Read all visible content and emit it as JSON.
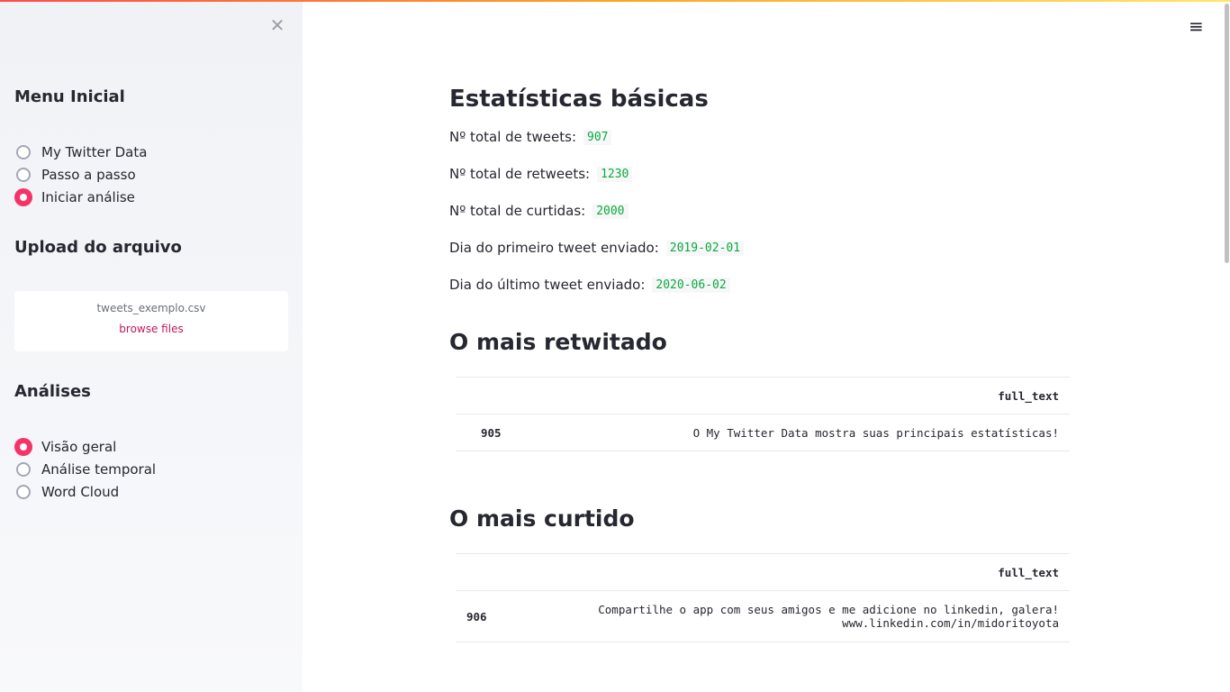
{
  "sidebar": {
    "close_icon": "close-icon",
    "menu_title": "Menu Inicial",
    "menu_options": [
      {
        "label": "My Twitter Data",
        "selected": false
      },
      {
        "label": "Passo a passo",
        "selected": false
      },
      {
        "label": "Iniciar análise",
        "selected": true
      }
    ],
    "upload_title": "Upload do arquivo",
    "upload_file_name": "tweets_exemplo.csv",
    "upload_browse": "browse files",
    "analyses_title": "Análises",
    "analyses_options": [
      {
        "label": "Visão geral",
        "selected": true
      },
      {
        "label": "Análise temporal",
        "selected": false
      },
      {
        "label": "Word Cloud",
        "selected": false
      }
    ]
  },
  "header": {
    "menu_icon": "hamburger-menu-icon",
    "menu_glyph": "≡"
  },
  "colors": {
    "accent": "#f63366",
    "code_green": "#09ab3b",
    "link": "#c2185b"
  },
  "main": {
    "title_basic": "Estatísticas básicas",
    "stats": [
      {
        "label": "Nº total de tweets:",
        "value": "907"
      },
      {
        "label": "Nº total de retweets:",
        "value": "1230"
      },
      {
        "label": "Nº total de curtidas:",
        "value": "2000"
      },
      {
        "label": "Dia do primeiro tweet enviado:",
        "value": "2019-02-01"
      },
      {
        "label": "Dia do último tweet enviado:",
        "value": "2020-06-02"
      }
    ],
    "most_retweeted": {
      "title": "O mais retwitado",
      "column": "full_text",
      "index": "905",
      "text": "O My Twitter Data mostra suas principais estatísticas!"
    },
    "most_liked": {
      "title": "O mais curtido",
      "column": "full_text",
      "index": "906",
      "text_line1": "Compartilhe o app com seus amigos e me adicione no linkedin, galera!",
      "text_line2": "www.linkedin.com/in/midoritoyota"
    }
  }
}
